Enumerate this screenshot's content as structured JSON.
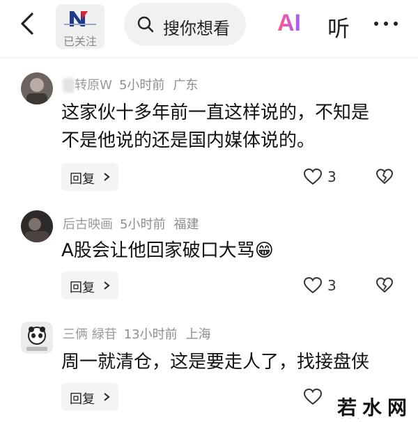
{
  "header": {
    "account_status": "已关注",
    "search_placeholder": "搜你想看",
    "ai_label": "AI",
    "listen_label": "听"
  },
  "comments": [
    {
      "name_visible": "转原W",
      "time": "5小时前",
      "location": "广东",
      "text_line1": "这家伙十多年前一直这样说的，不知是",
      "text_line2": "不是他说的还是国内媒体说的。",
      "reply_label": "回复",
      "likes": "3"
    },
    {
      "name_visible": "后古映画",
      "time": "5小时前",
      "location": "福建",
      "text_line1": "A股会让他回家破口大骂😁",
      "reply_label": "回复",
      "likes": "3"
    },
    {
      "name_visible": "三俩 緑苷",
      "time": "13小时前",
      "location": "上海",
      "text_line1": "周一就清仓，这是要走人了，找接盘侠",
      "reply_label": "回复",
      "likes": ""
    }
  ],
  "watermark": {
    "text": "若水网"
  }
}
